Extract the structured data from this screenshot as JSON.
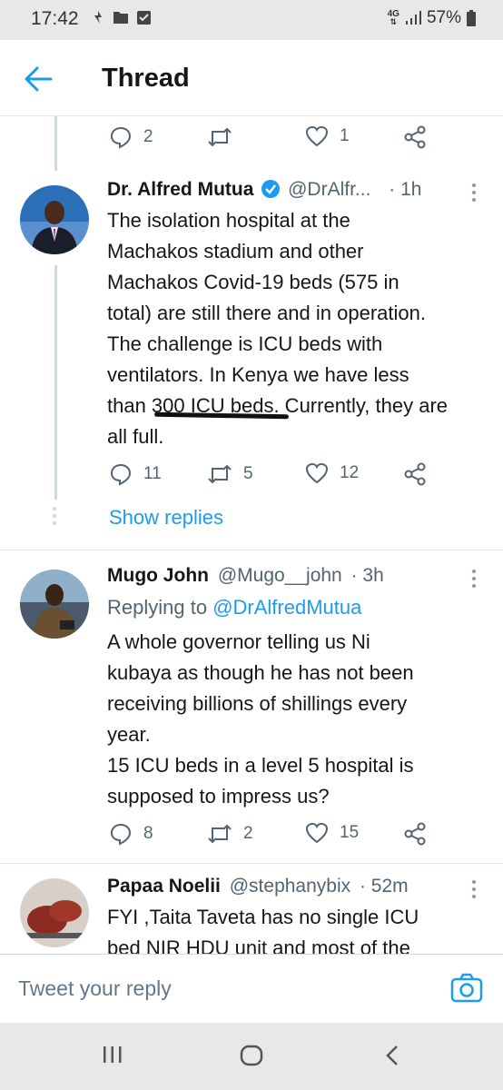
{
  "status_bar": {
    "time": "17:42",
    "network": "4G",
    "battery": "57%"
  },
  "header": {
    "title": "Thread"
  },
  "top_actions": {
    "replies": "2",
    "retweets": "",
    "likes": "1"
  },
  "tweets": [
    {
      "name": "Dr. Alfred Mutua",
      "handle": "@DrAlfr...",
      "time": "· 1h",
      "verified": true,
      "lines": [
        "The isolation hospital at the",
        "Machakos stadium and other",
        "Machakos Covid-19  beds (575 in",
        "total) are still there and in operation.",
        "The challenge is ICU beds with",
        "ventilators. In Kenya we have less",
        "than 300 ICU beds. Currently, they are",
        "all full."
      ],
      "replies": "11",
      "retweets": "5",
      "likes": "12",
      "show_replies": "Show replies"
    },
    {
      "name": "Mugo John",
      "handle": "@Mugo__john",
      "time": "· 3h",
      "replying_label": "Replying to ",
      "replying_handle": "@DrAlfredMutua",
      "lines": [
        "A whole governor telling us Ni",
        "kubaya as though he has not been",
        "receiving billions of shillings every",
        "year.",
        "15 ICU beds in a level 5 hospital is",
        "supposed to impress us?"
      ],
      "replies": "8",
      "retweets": "2",
      "likes": "15"
    },
    {
      "name": "Papaa Noelii",
      "handle": "@stephanybix",
      "time": "· 52m",
      "lines": [
        "FYI ,Taita Taveta has no single ICU",
        "bed NIR HDU unit and most of the"
      ]
    }
  ],
  "reply_bar": {
    "placeholder": "Tweet your reply"
  },
  "colors": {
    "accent": "#1d9bf0",
    "text": "#14171a",
    "muted": "#536471"
  }
}
